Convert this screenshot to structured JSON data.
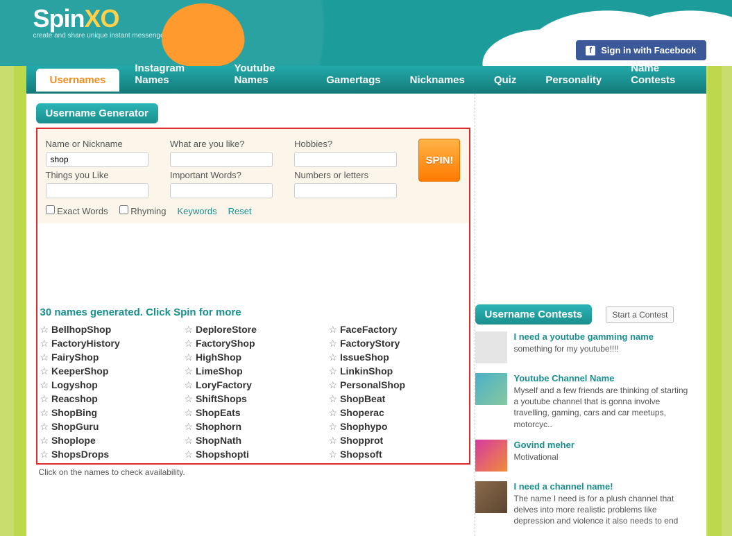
{
  "brand": {
    "spin": "Spin",
    "xo": "XO",
    "tagline": "create and share unique instant messenger content"
  },
  "fb": {
    "label": "Sign in with Facebook"
  },
  "tabs": [
    "Usernames",
    "Instagram Names",
    "Youtube Names",
    "Gamertags",
    "Nicknames",
    "Quiz",
    "Personality",
    "Name Contests"
  ],
  "heading": "Username Generator",
  "form": {
    "labels": {
      "name": "Name or Nickname",
      "like": "What are you like?",
      "hobbies": "Hobbies?",
      "things": "Things you Like",
      "words": "Important Words?",
      "numbers": "Numbers or letters"
    },
    "values": {
      "name": "shop"
    },
    "spin": "SPIN!",
    "exact": "Exact Words",
    "rhyming": "Rhyming",
    "keywords": "Keywords",
    "reset": "Reset"
  },
  "generated_line": "30 names generated. Click Spin for more",
  "names": [
    "BellhopShop",
    "DeploreStore",
    "FaceFactory",
    "FactoryHistory",
    "FactoryShop",
    "FactoryStory",
    "FairyShop",
    "HighShop",
    "IssueShop",
    "KeeperShop",
    "LimeShop",
    "LinkinShop",
    "Logyshop",
    "LoryFactory",
    "PersonalShop",
    "Reacshop",
    "ShiftShops",
    "ShopBeat",
    "ShopBing",
    "ShopEats",
    "Shoperac",
    "ShopGuru",
    "Shophorn",
    "Shophypo",
    "Shoplope",
    "ShopNath",
    "Shopprot",
    "ShopsDrops",
    "Shopshopti",
    "Shopsoft"
  ],
  "availability_note": "Click on the names to check availability.",
  "contests": {
    "title": "Username Contests",
    "start": "Start a Contest",
    "items": [
      {
        "title": "I need a youtube gamming name",
        "desc": "something for my youtube!!!!"
      },
      {
        "title": "Youtube Channel Name",
        "desc": "Myself and a few friends are thinking of starting a youtube channel that is gonna involve travelling, gaming, cars and car meetups, motorcyc.."
      },
      {
        "title": "Govind meher",
        "desc": "Motivational"
      },
      {
        "title": "I need a channel name!",
        "desc": "The name I need is for a plush channel that delves into more realistic problems like depression and violence it also needs to end"
      }
    ]
  }
}
